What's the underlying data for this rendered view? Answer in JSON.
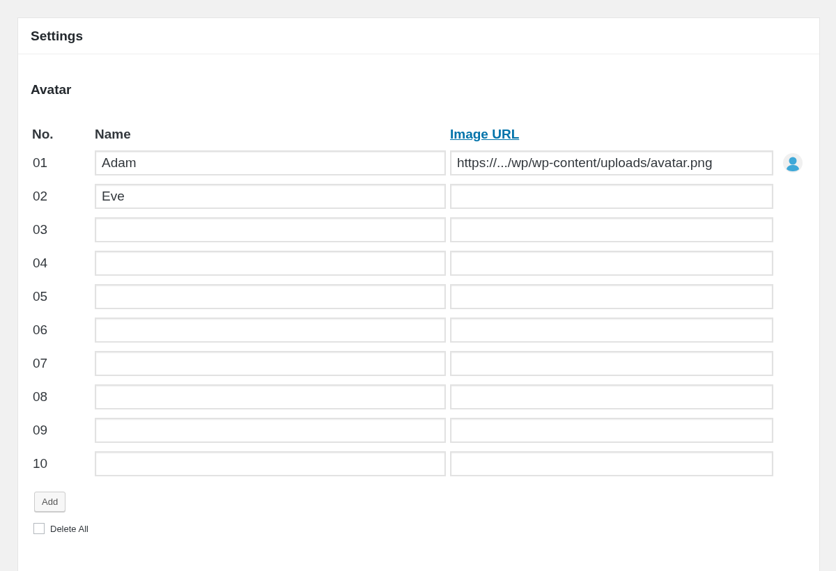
{
  "panel": {
    "title": "Settings"
  },
  "section": {
    "title": "Avatar"
  },
  "table": {
    "columns": [
      "No.",
      "Name",
      "Image URL"
    ],
    "rows": [
      {
        "no": "01",
        "name": "Adam",
        "image_url": "https://.../wp/wp-content/uploads/avatar.png"
      },
      {
        "no": "02",
        "name": "Eve",
        "image_url": ""
      },
      {
        "no": "03",
        "name": "",
        "image_url": ""
      },
      {
        "no": "04",
        "name": "",
        "image_url": ""
      },
      {
        "no": "05",
        "name": "",
        "image_url": ""
      },
      {
        "no": "06",
        "name": "",
        "image_url": ""
      },
      {
        "no": "07",
        "name": "",
        "image_url": ""
      },
      {
        "no": "08",
        "name": "",
        "image_url": ""
      },
      {
        "no": "09",
        "name": "",
        "image_url": ""
      },
      {
        "no": "10",
        "name": "",
        "image_url": ""
      }
    ]
  },
  "add_button": "Add",
  "delete_all": {
    "label": "Delete All",
    "checked": false
  }
}
